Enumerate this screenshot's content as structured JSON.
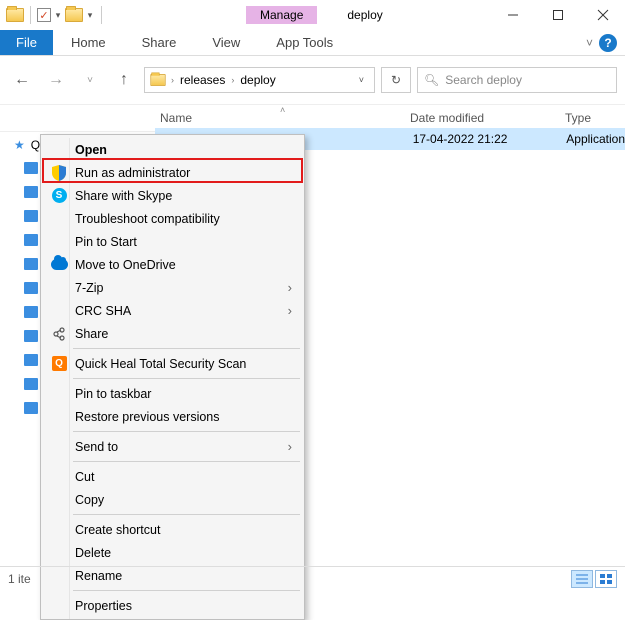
{
  "window": {
    "context_tab": "Manage",
    "title": "deploy"
  },
  "ribbon": {
    "file": "File",
    "tabs": [
      "Home",
      "Share",
      "View",
      "App Tools"
    ],
    "expand": "˅"
  },
  "address": {
    "crumbs": [
      "releases",
      "deploy"
    ]
  },
  "search": {
    "placeholder": "Search deploy"
  },
  "columns": {
    "name": "Name",
    "date": "Date modified",
    "type": "Type"
  },
  "sidebar": {
    "quick_access": "Quick access"
  },
  "file": {
    "name": "",
    "date": "17-04-2022 21:22",
    "type": "Application"
  },
  "context_menu": {
    "open": "Open",
    "run_admin": "Run as administrator",
    "skype": "Share with Skype",
    "troubleshoot": "Troubleshoot compatibility",
    "pin_start": "Pin to Start",
    "onedrive": "Move to OneDrive",
    "sevenzip": "7-Zip",
    "crc": "CRC SHA",
    "share": "Share",
    "quickheal": "Quick Heal Total Security Scan",
    "pin_taskbar": "Pin to taskbar",
    "restore": "Restore previous versions",
    "sendto": "Send to",
    "cut": "Cut",
    "copy": "Copy",
    "shortcut": "Create shortcut",
    "delete": "Delete",
    "rename": "Rename",
    "properties": "Properties"
  },
  "status": {
    "text": "1 ite"
  }
}
